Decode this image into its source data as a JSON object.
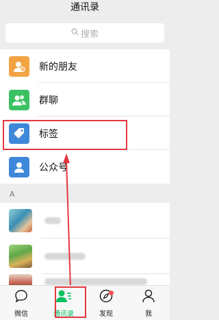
{
  "header": {
    "title": "通讯录"
  },
  "search": {
    "placeholder": "搜索"
  },
  "function_items": [
    {
      "label": "新的朋友",
      "icon": "add-friend-icon",
      "color": "#f2a343"
    },
    {
      "label": "群聊",
      "icon": "group-chat-icon",
      "color": "#3cc162"
    },
    {
      "label": "标签",
      "icon": "tag-icon",
      "color": "#3f88d9"
    },
    {
      "label": "公众号",
      "icon": "official-account-icon",
      "color": "#3f88d9"
    }
  ],
  "section": {
    "letter": "A"
  },
  "tabs": [
    {
      "label": "微信",
      "icon": "chat-bubble-icon"
    },
    {
      "label": "通讯录",
      "icon": "contacts-icon",
      "active": true
    },
    {
      "label": "发现",
      "icon": "compass-icon",
      "badge": true
    },
    {
      "label": "我",
      "icon": "person-icon"
    }
  ],
  "colors": {
    "accent": "#07c160",
    "annotation": "#e5373f"
  }
}
